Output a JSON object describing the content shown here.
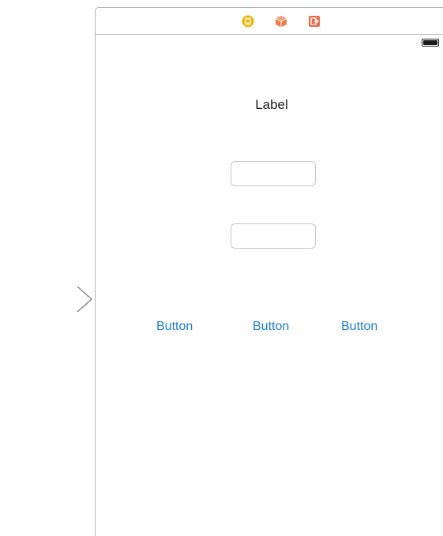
{
  "scene": {
    "dock_icons": [
      "view-controller-icon",
      "first-responder-icon",
      "exit-icon"
    ],
    "status_bar": {
      "battery_icon": "battery-icon"
    },
    "label": {
      "text": "Label"
    },
    "text_fields": [
      {
        "value": "",
        "placeholder": ""
      },
      {
        "value": "",
        "placeholder": ""
      }
    ],
    "buttons": [
      {
        "label": "Button"
      },
      {
        "label": "Button"
      },
      {
        "label": "Button"
      }
    ]
  },
  "colors": {
    "button_tint": "#1b7fd4",
    "view_controller": "#f2b300",
    "first_responder": "#f07a4a",
    "exit": "#ee6b45"
  }
}
